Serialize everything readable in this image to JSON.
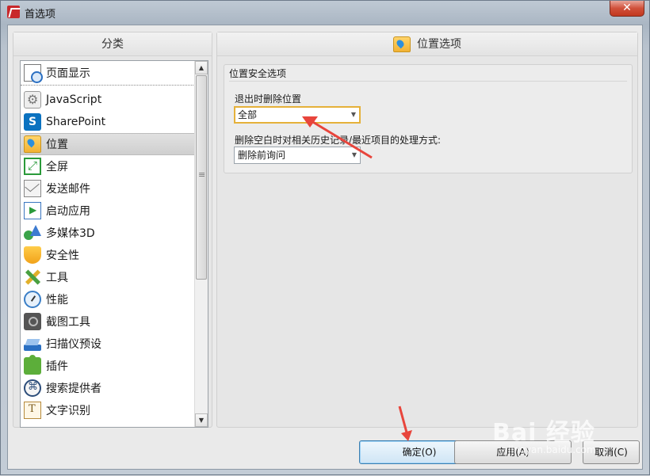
{
  "window": {
    "title": "首选项",
    "close_label": "✕"
  },
  "category_panel": {
    "header": "分类",
    "items": [
      {
        "label": "页面显示",
        "icon": "page-display-icon"
      },
      {
        "label": "JavaScript",
        "icon": "javascript-gear-icon"
      },
      {
        "label": "SharePoint",
        "icon": "sharepoint-icon"
      },
      {
        "label": "位置",
        "icon": "location-folder-icon",
        "selected": true
      },
      {
        "label": "全屏",
        "icon": "fullscreen-icon"
      },
      {
        "label": "发送邮件",
        "icon": "mail-icon"
      },
      {
        "label": "启动应用",
        "icon": "launch-app-icon"
      },
      {
        "label": "多媒体3D",
        "icon": "multimedia-3d-icon"
      },
      {
        "label": "安全性",
        "icon": "shield-icon"
      },
      {
        "label": "工具",
        "icon": "tools-icon"
      },
      {
        "label": "性能",
        "icon": "gauge-icon"
      },
      {
        "label": "截图工具",
        "icon": "camera-icon"
      },
      {
        "label": "扫描仪预设",
        "icon": "scanner-icon"
      },
      {
        "label": "插件",
        "icon": "plugin-icon"
      },
      {
        "label": "搜索提供者",
        "icon": "search-provider-icon"
      },
      {
        "label": "文字识别",
        "icon": "ocr-icon"
      }
    ]
  },
  "options_panel": {
    "header": "位置选项",
    "group_title": "位置安全选项",
    "field1": {
      "label": "退出时删除位置",
      "value": "全部"
    },
    "field2": {
      "label": "删除空白时对相关历史记录/最近项目的处理方式:",
      "value": "删除前询问"
    }
  },
  "buttons": {
    "ok": "确定(O)",
    "apply": "应用(A)",
    "cancel": "取消(C)"
  },
  "watermark": {
    "main": "Bai 经验",
    "sub": "jingyan.baidu.com"
  },
  "colors": {
    "annotation_arrow": "#e8453c",
    "focus_border": "#e5b13a",
    "default_button_border": "#3c7fb1"
  }
}
